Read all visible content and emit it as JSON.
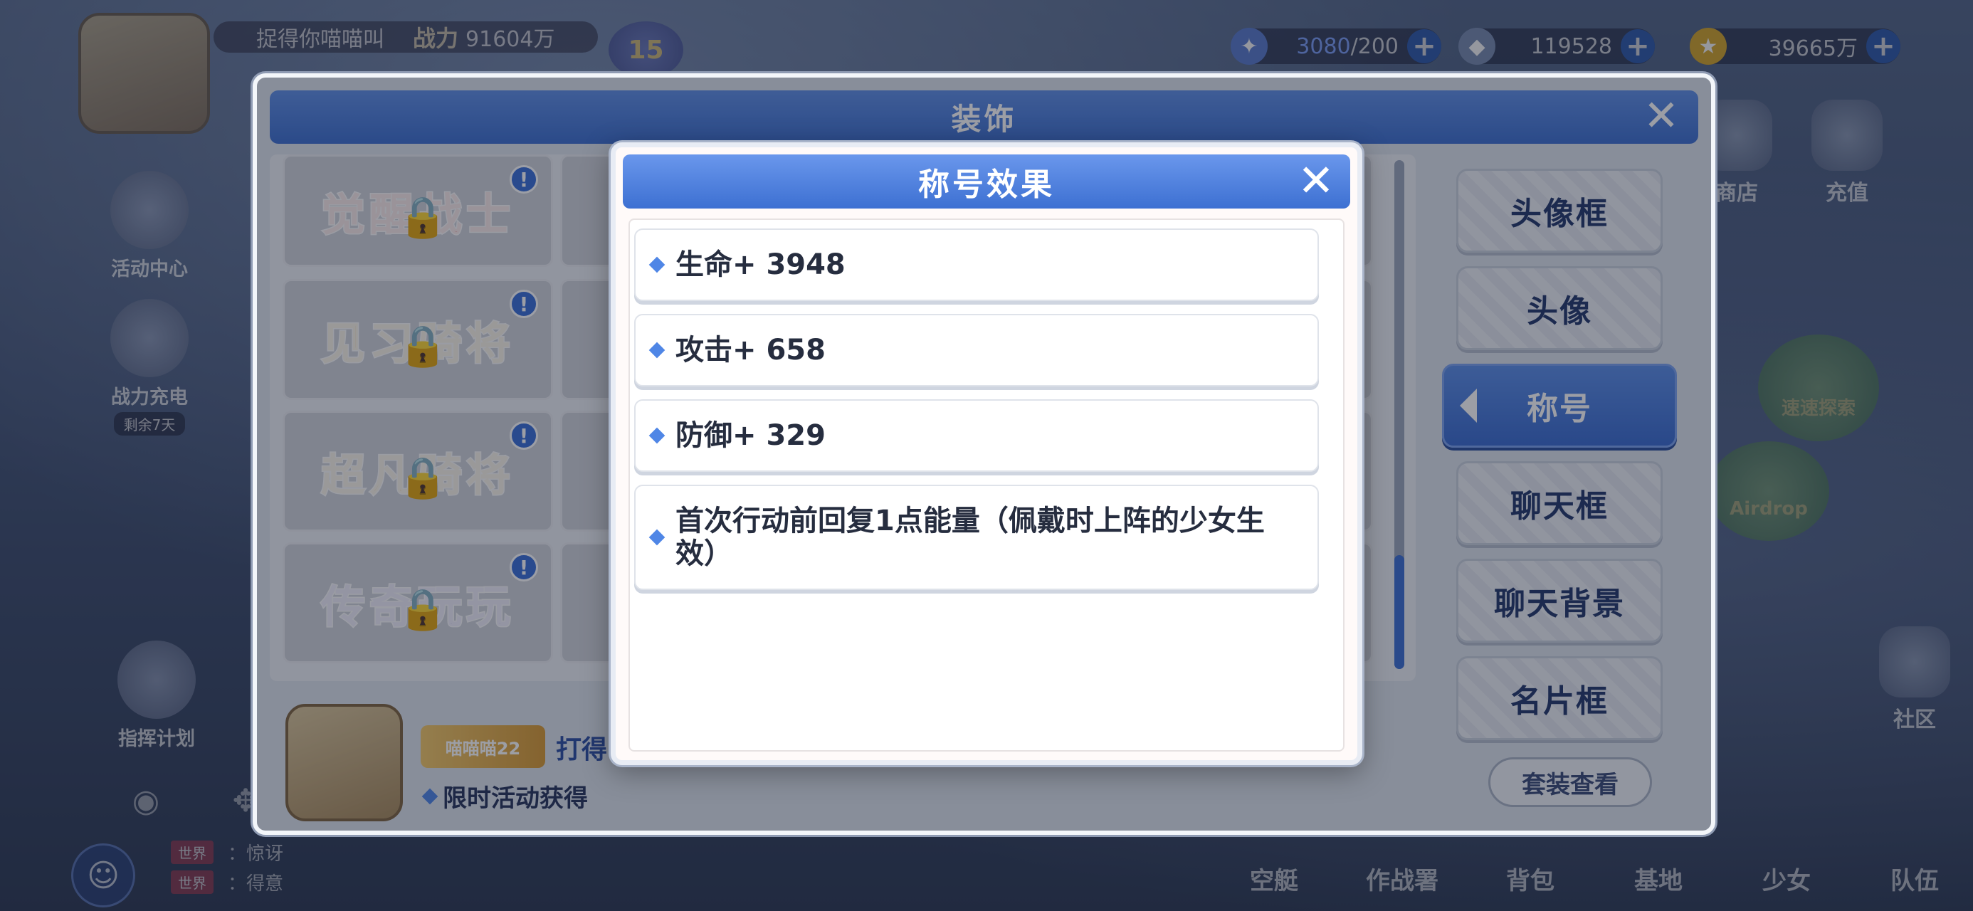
{
  "player": {
    "name": "捉得你喵喵叫",
    "power_label": "战力",
    "power_value": "91604万",
    "level": "15"
  },
  "resources": {
    "energy_current": "3080",
    "energy_max": "/200",
    "crystal": "119528",
    "gold": "39665万"
  },
  "left_menu": {
    "activity_center": "活动中心",
    "power_charge": "战力充电",
    "power_charge_sub": "剩余7天",
    "command_plan": "指挥计划"
  },
  "right_menu": {
    "shop": "商店",
    "recharge": "充值",
    "community": "社区",
    "event_probe": "速速探索",
    "event_airdrop": "Airdrop"
  },
  "chat": {
    "line1_tag": "世界",
    "line1_text": "：惊讶",
    "line2_tag": "世界",
    "line2_text": "：得意"
  },
  "bottom_nav": [
    "空艇",
    "作战署",
    "背包",
    "基地",
    "少女",
    "队伍"
  ],
  "decoration": {
    "title": "装饰",
    "grid_titles": [
      {
        "text": "觉醒战士",
        "color": "#d8423b"
      },
      {
        "text": "见习骑将",
        "color": "#e2a327"
      },
      {
        "text": "超凡骑将",
        "color": "#e0a52b"
      },
      {
        "text": "传奇玩玩",
        "color": "#7c6bd6"
      }
    ],
    "tabs": [
      "头像框",
      "头像",
      "称号",
      "聊天框",
      "聊天背景",
      "名片框"
    ],
    "active_tab_index": 2,
    "set_button": "套装查看",
    "preview_title_text": "喵喵喵22",
    "preview_get": "打得",
    "preview_source": "限时活动获得"
  },
  "effect_modal": {
    "title": "称号效果",
    "rows": [
      "生命+ 3948",
      "攻击+ 658",
      "防御+ 329",
      "首次行动前回复1点能量（佩戴时上阵的少女生效）"
    ]
  }
}
